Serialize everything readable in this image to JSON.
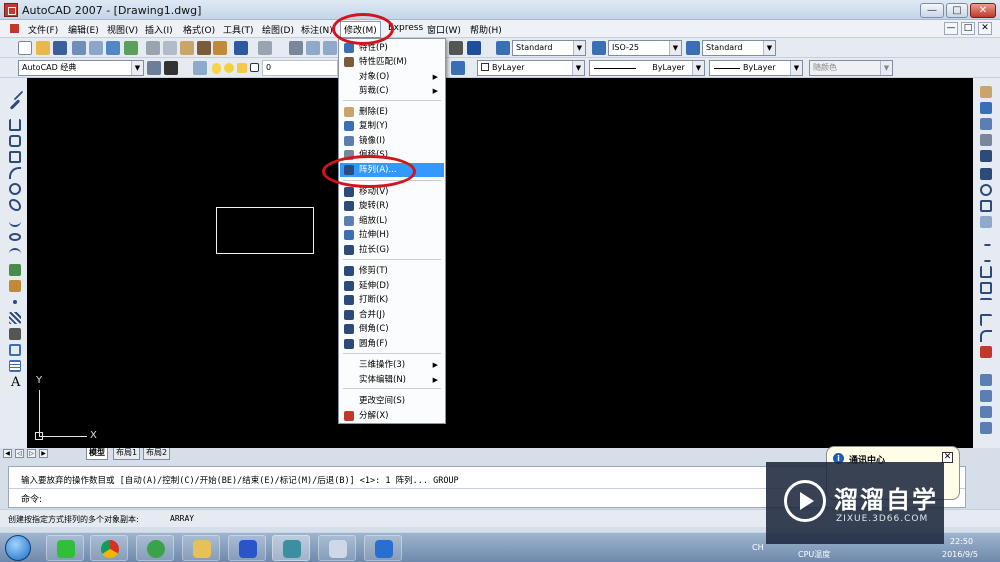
{
  "window": {
    "title": "AutoCAD 2007 - [Drawing1.dwg]",
    "min": "—",
    "max": "□",
    "close": "✕"
  },
  "menubar": {
    "items": [
      "文件(F)",
      "编辑(E)",
      "视图(V)",
      "插入(I)",
      "格式(O)",
      "工具(T)",
      "绘图(D)",
      "标注(N)",
      "修改(M)",
      "Express",
      "窗口(W)",
      "帮助(H)"
    ],
    "active": "修改(M)",
    "doc_min": "—",
    "doc_max": "□",
    "doc_close": "✕"
  },
  "toolbar1": {
    "textstyle": "Standard",
    "dimstyle": "ISO-25",
    "tablestyle": "Standard"
  },
  "toolbar2": {
    "workspace": "AutoCAD 经典",
    "layer": "0",
    "color": "ByLayer",
    "linetype": "ByLayer",
    "lineweight": "ByLayer",
    "plotstyle": "随颜色"
  },
  "canvas": {
    "ucs_x": "X",
    "ucs_y": "Y"
  },
  "tabs": [
    "模型",
    "布局1",
    "布局2"
  ],
  "command": {
    "history": "输入要放弃的操作数目或 [自动(A)/控制(C)/开始(BE)/结束(E)/标记(M)/后退(B)] <1>: 1 阵列... GROUP",
    "prompt": "命令:"
  },
  "status": {
    "help": "创建按指定方式排列的多个对象副本:",
    "cmd": "ARRAY"
  },
  "modify_menu": {
    "items": [
      {
        "label": "特性(P)",
        "icon": "properties-icon"
      },
      {
        "label": "特性匹配(M)",
        "icon": "match-properties-icon"
      },
      {
        "label": "对象(O)",
        "icon": "",
        "submenu": true
      },
      {
        "label": "剪裁(C)",
        "icon": "",
        "submenu": true
      },
      {
        "label": "删除(E)",
        "icon": "erase-icon"
      },
      {
        "label": "复制(Y)",
        "icon": "copy-icon"
      },
      {
        "label": "镜像(I)",
        "icon": "mirror-icon"
      },
      {
        "label": "偏移(S)",
        "icon": "offset-icon"
      },
      {
        "label": "阵列(A)...",
        "icon": "array-icon",
        "highlight": true
      },
      {
        "label": "移动(V)",
        "icon": "move-icon"
      },
      {
        "label": "旋转(R)",
        "icon": "rotate-icon"
      },
      {
        "label": "缩放(L)",
        "icon": "scale-icon"
      },
      {
        "label": "拉伸(H)",
        "icon": "stretch-icon"
      },
      {
        "label": "拉长(G)",
        "icon": "lengthen-icon"
      },
      {
        "label": "修剪(T)",
        "icon": "trim-icon"
      },
      {
        "label": "延伸(D)",
        "icon": "extend-icon"
      },
      {
        "label": "打断(K)",
        "icon": "break-icon"
      },
      {
        "label": "合并(J)",
        "icon": "join-icon"
      },
      {
        "label": "倒角(C)",
        "icon": "chamfer-icon"
      },
      {
        "label": "圆角(F)",
        "icon": "fillet-icon"
      },
      {
        "label": "三维操作(3)",
        "icon": "",
        "submenu": true
      },
      {
        "label": "实体编辑(N)",
        "icon": "",
        "submenu": true
      },
      {
        "label": "更改空间(S)",
        "icon": ""
      },
      {
        "label": "分解(X)",
        "icon": "explode-icon"
      }
    ]
  },
  "notification": {
    "title": "通讯中心",
    "close": "✕"
  },
  "watermark": {
    "brand": "溜溜自学",
    "site": "ZIXUE.3D66.COM"
  },
  "tray": {
    "ime": "CH",
    "cpu": "CPU温度",
    "time": "22:50",
    "date": "2016/9/5"
  },
  "taskbar": {
    "apps": [
      "wechat-icon",
      "chrome-icon",
      "ie-icon",
      "explorer-icon",
      "baidu-icon",
      "autocad-icon",
      "paint-icon",
      "game-icon"
    ]
  }
}
